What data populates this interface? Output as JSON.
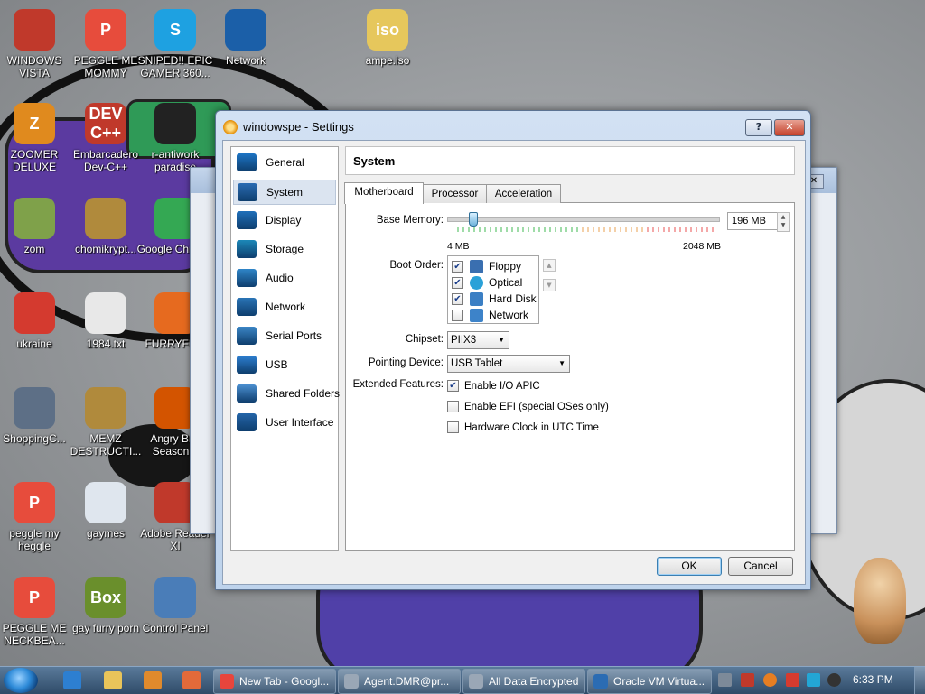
{
  "desktop": {
    "icons": [
      {
        "label": "WINDOWS VISTA",
        "color": "#c0392b",
        "glyph": ""
      },
      {
        "label": "PEGGLE ME MOMMY",
        "color": "#e74c3c",
        "glyph": "P"
      },
      {
        "label": "SNIPED!! EPIC GAMER 360...",
        "color": "#1ea1e1",
        "glyph": "S"
      },
      {
        "label": "Network",
        "color": "#1b5fa8",
        "glyph": ""
      },
      {
        "label": "ampe.iso",
        "color": "#e6c75c",
        "glyph": "iso"
      },
      {
        "label": "ZOOMER DELUXE",
        "color": "#e08a1e",
        "glyph": "Z"
      },
      {
        "label": "Embarcadero Dev-C++",
        "color": "#c0392b",
        "glyph": "DEV C++"
      },
      {
        "label": "r-antiwork paradise",
        "color": "#222222",
        "glyph": ""
      },
      {
        "label": "zom",
        "color": "#7fa14a",
        "glyph": ""
      },
      {
        "label": "chomikrypt...",
        "color": "#b08a3c",
        "glyph": ""
      },
      {
        "label": "Google Chrome",
        "color": "#34a853",
        "glyph": ""
      },
      {
        "label": "ukraine",
        "color": "#d43a2f",
        "glyph": ""
      },
      {
        "label": "1984.txt",
        "color": "#e8e8e8",
        "glyph": ""
      },
      {
        "label": "FURRYFU...",
        "color": "#e66a1f",
        "glyph": ""
      },
      {
        "label": "ShoppingC...",
        "color": "#5d6f86",
        "glyph": ""
      },
      {
        "label": "MEMZ DESTRUCTI...",
        "color": "#b08a3c",
        "glyph": ""
      },
      {
        "label": "Angry Bi... Season...",
        "color": "#d35400",
        "glyph": ""
      },
      {
        "label": "peggle my heggle",
        "color": "#e74c3c",
        "glyph": "P"
      },
      {
        "label": "gaymes",
        "color": "#dfe6ee",
        "glyph": ""
      },
      {
        "label": "Adobe Reader XI",
        "color": "#c0392b",
        "glyph": ""
      },
      {
        "label": "PEGGLE ME NECKBEA...",
        "color": "#e74c3c",
        "glyph": "P"
      },
      {
        "label": "gay furry porn",
        "color": "#6a8f2c",
        "glyph": "Box"
      },
      {
        "label": "Control Panel",
        "color": "#4a7db8",
        "glyph": ""
      }
    ]
  },
  "dialog": {
    "title": "windowspe - Settings",
    "help_label": "?",
    "close_label": "✕",
    "sidebar": [
      {
        "label": "General"
      },
      {
        "label": "System"
      },
      {
        "label": "Display"
      },
      {
        "label": "Storage"
      },
      {
        "label": "Audio"
      },
      {
        "label": "Network"
      },
      {
        "label": "Serial Ports"
      },
      {
        "label": "USB"
      },
      {
        "label": "Shared Folders"
      },
      {
        "label": "User Interface"
      }
    ],
    "selected_section": "System",
    "header_title": "System",
    "tabs": [
      {
        "label": "Motherboard"
      },
      {
        "label": "Processor"
      },
      {
        "label": "Acceleration"
      }
    ],
    "active_tab": "Motherboard",
    "motherboard": {
      "base_memory_label": "Base Memory:",
      "base_memory_value": "196 MB",
      "memory_min_label": "4 MB",
      "memory_max_label": "2048 MB",
      "memory_mb": 196,
      "memory_min_mb": 4,
      "memory_max_mb": 2048,
      "boot_order_label": "Boot Order:",
      "boot_order": [
        {
          "label": "Floppy",
          "checked": true,
          "icon": "floppy-icon"
        },
        {
          "label": "Optical",
          "checked": true,
          "icon": "optical-disc-icon"
        },
        {
          "label": "Hard Disk",
          "checked": true,
          "icon": "hard-disk-icon"
        },
        {
          "label": "Network",
          "checked": false,
          "icon": "network-icon"
        }
      ],
      "chipset_label": "Chipset:",
      "chipset_value": "PIIX3",
      "pointing_label": "Pointing Device:",
      "pointing_value": "USB Tablet",
      "extended_label": "Extended Features:",
      "features": [
        {
          "label": "Enable I/O APIC",
          "checked": true
        },
        {
          "label": "Enable EFI (special OSes only)",
          "checked": false
        },
        {
          "label": "Hardware Clock in UTC Time",
          "checked": false
        }
      ]
    },
    "ok_label": "OK",
    "cancel_label": "Cancel"
  },
  "taskbar": {
    "tasks": [
      {
        "label": "New Tab - Googl...",
        "color": "#e8453c"
      },
      {
        "label": "Agent.DMR@pr...",
        "color": "#9aa7b6"
      },
      {
        "label": "All Data Encrypted",
        "color": "#9aa7b6"
      },
      {
        "label": "Oracle VM Virtua...",
        "color": "#2b6cb3"
      }
    ],
    "clock": "6:33 PM"
  }
}
